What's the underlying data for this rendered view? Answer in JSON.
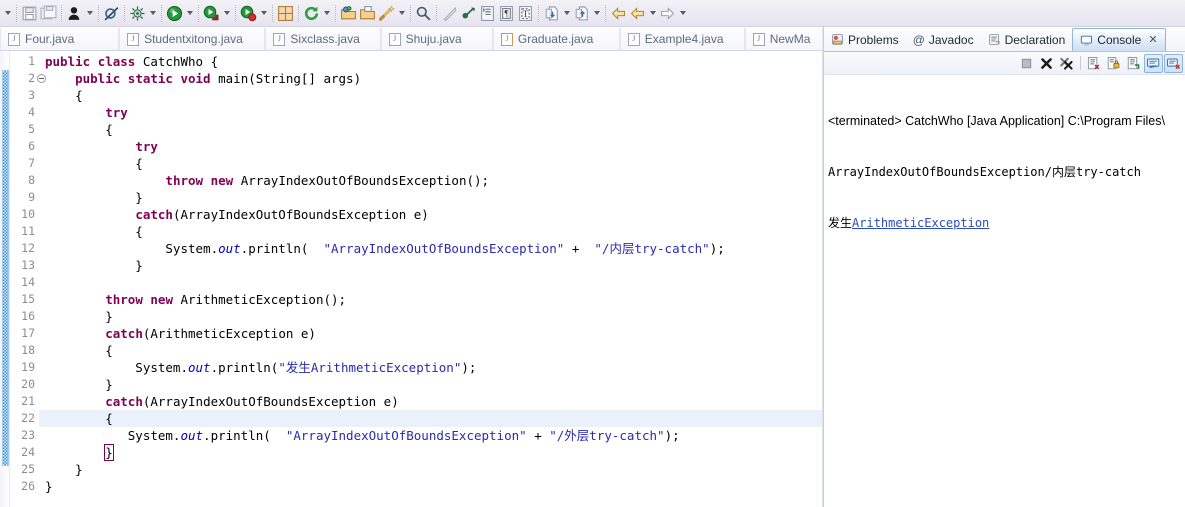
{
  "toolbar": {
    "items": [
      {
        "name": "toolbar-dropdown-arrow-0",
        "type": "arrow"
      },
      {
        "name": "separator-0",
        "type": "sep"
      },
      {
        "name": "save-icon",
        "type": "icon",
        "glyph": "save"
      },
      {
        "name": "save-all-icon",
        "type": "icon",
        "glyph": "save-all"
      },
      {
        "name": "separator-1",
        "type": "sep"
      },
      {
        "name": "run-person-icon",
        "type": "icon",
        "glyph": "person"
      },
      {
        "name": "run-person-dropdown-arrow",
        "type": "arrow"
      },
      {
        "name": "separator-2",
        "type": "sep"
      },
      {
        "name": "skip-breakpoints-icon",
        "type": "icon",
        "glyph": "skip-bp"
      },
      {
        "name": "separator-3",
        "type": "sep"
      },
      {
        "name": "debug-icon",
        "type": "icon",
        "glyph": "bug"
      },
      {
        "name": "debug-dropdown-arrow",
        "type": "arrow"
      },
      {
        "name": "separator-4",
        "type": "sep"
      },
      {
        "name": "run-icon",
        "type": "icon",
        "glyph": "run"
      },
      {
        "name": "run-dropdown-arrow",
        "type": "arrow"
      },
      {
        "name": "separator-5",
        "type": "sep"
      },
      {
        "name": "run-external-tools-icon",
        "type": "icon",
        "glyph": "ext-run"
      },
      {
        "name": "run-external-dropdown-arrow",
        "type": "arrow"
      },
      {
        "name": "separator-6",
        "type": "sep"
      },
      {
        "name": "run-coverage-icon",
        "type": "icon",
        "glyph": "cov-run"
      },
      {
        "name": "run-coverage-dropdown-arrow",
        "type": "arrow"
      },
      {
        "name": "separator-7",
        "type": "sep"
      },
      {
        "name": "new-package-icon",
        "type": "icon",
        "glyph": "package"
      },
      {
        "name": "separator-8",
        "type": "sep"
      },
      {
        "name": "refresh-icon",
        "type": "icon",
        "glyph": "refresh"
      },
      {
        "name": "refresh-dropdown-arrow",
        "type": "arrow"
      },
      {
        "name": "separator-9",
        "type": "sep"
      },
      {
        "name": "open-type-icon",
        "type": "icon",
        "glyph": "open-type"
      },
      {
        "name": "open-task-icon",
        "type": "icon",
        "glyph": "open-task"
      },
      {
        "name": "quick-fix-icon",
        "type": "icon",
        "glyph": "wand"
      },
      {
        "name": "quick-fix-dropdown-arrow",
        "type": "arrow"
      },
      {
        "name": "separator-10",
        "type": "sep"
      },
      {
        "name": "search-icon",
        "type": "icon",
        "glyph": "search"
      },
      {
        "name": "separator-11",
        "type": "sep"
      },
      {
        "name": "next-annotation-icon",
        "type": "icon",
        "glyph": "next-ann"
      },
      {
        "name": "link-icon",
        "type": "icon",
        "glyph": "link"
      },
      {
        "name": "toggle-mark-icon",
        "type": "icon",
        "glyph": "mark"
      },
      {
        "name": "show-whitespace-icon",
        "type": "icon",
        "glyph": "whitespace"
      },
      {
        "name": "block-selection-icon",
        "type": "icon",
        "glyph": "block-sel"
      },
      {
        "name": "separator-12",
        "type": "sep"
      },
      {
        "name": "next-edit-icon",
        "type": "icon",
        "glyph": "next-edit"
      },
      {
        "name": "next-edit-dropdown-arrow",
        "type": "arrow"
      },
      {
        "name": "prev-edit-icon",
        "type": "icon",
        "glyph": "prev-edit"
      },
      {
        "name": "prev-edit-dropdown-arrow",
        "type": "arrow"
      },
      {
        "name": "separator-13",
        "type": "sep"
      },
      {
        "name": "back-icon",
        "type": "icon",
        "glyph": "back"
      },
      {
        "name": "back-2-icon",
        "type": "icon",
        "glyph": "back"
      },
      {
        "name": "back-dropdown-arrow",
        "type": "arrow"
      },
      {
        "name": "forward-icon",
        "type": "icon",
        "glyph": "forward"
      },
      {
        "name": "forward-dropdown-arrow",
        "type": "arrow"
      }
    ]
  },
  "editor_tabs": [
    {
      "label": "Four.java",
      "modified": false
    },
    {
      "label": "Studentxitong.java",
      "modified": false
    },
    {
      "label": "Sixclass.java",
      "modified": false
    },
    {
      "label": "Shuju.java",
      "modified": false
    },
    {
      "label": "Graduate.java",
      "modified": true
    },
    {
      "label": "Example4.java",
      "modified": false
    },
    {
      "label": "NewMa",
      "modified": false
    }
  ],
  "console_panel": {
    "tabs": [
      {
        "label": "Problems",
        "icon": "problems-icon",
        "active": false
      },
      {
        "label": "Javadoc",
        "icon": "javadoc-icon",
        "active": false
      },
      {
        "label": "Declaration",
        "icon": "declaration-icon",
        "active": false
      },
      {
        "label": "Console",
        "icon": "console-icon",
        "active": true
      }
    ],
    "close_glyph": "✕",
    "toolbar_icons": [
      {
        "name": "terminate-icon",
        "glyph": "terminate",
        "selected": false
      },
      {
        "name": "remove-launch-icon",
        "glyph": "remove",
        "selected": false
      },
      {
        "name": "remove-all-terminated-icon",
        "glyph": "remove-all",
        "selected": false
      },
      {
        "name": "separator",
        "glyph": "sep",
        "selected": false
      },
      {
        "name": "clear-console-icon",
        "glyph": "clear",
        "selected": false
      },
      {
        "name": "scroll-lock-icon",
        "glyph": "lock",
        "selected": false
      },
      {
        "name": "pin-console-icon",
        "glyph": "pin",
        "selected": false
      },
      {
        "name": "display-selected-console-icon",
        "glyph": "display",
        "selected": true
      },
      {
        "name": "open-console-icon",
        "glyph": "open-console",
        "selected": true
      }
    ],
    "output": {
      "header": "<terminated> CatchWho [Java Application] C:\\Program Files\\",
      "line1": "ArrayIndexOutOfBoundsException/内层try-catch",
      "line2_prefix": "发生",
      "line2_link": "ArithmeticException"
    }
  },
  "code": {
    "total_lines": 26,
    "current_line": 22,
    "fold_marker_line": 2,
    "lines": [
      {
        "n": 1,
        "tokens": [
          {
            "t": "public",
            "c": "kw"
          },
          {
            "t": " ",
            "c": ""
          },
          {
            "t": "class",
            "c": "kw"
          },
          {
            "t": " CatchWho {",
            "c": ""
          }
        ]
      },
      {
        "n": 2,
        "tokens": [
          {
            "t": "    ",
            "c": ""
          },
          {
            "t": "public",
            "c": "kw"
          },
          {
            "t": " ",
            "c": ""
          },
          {
            "t": "static",
            "c": "kw"
          },
          {
            "t": " ",
            "c": ""
          },
          {
            "t": "void",
            "c": "kw"
          },
          {
            "t": " main(String[] args)",
            "c": ""
          }
        ]
      },
      {
        "n": 3,
        "tokens": [
          {
            "t": "    {",
            "c": ""
          }
        ]
      },
      {
        "n": 4,
        "tokens": [
          {
            "t": "        ",
            "c": ""
          },
          {
            "t": "try",
            "c": "kw"
          }
        ]
      },
      {
        "n": 5,
        "tokens": [
          {
            "t": "        {",
            "c": ""
          }
        ]
      },
      {
        "n": 6,
        "tokens": [
          {
            "t": "            ",
            "c": ""
          },
          {
            "t": "try",
            "c": "kw"
          }
        ]
      },
      {
        "n": 7,
        "tokens": [
          {
            "t": "            {",
            "c": ""
          }
        ]
      },
      {
        "n": 8,
        "tokens": [
          {
            "t": "                ",
            "c": ""
          },
          {
            "t": "throw",
            "c": "kw"
          },
          {
            "t": " ",
            "c": ""
          },
          {
            "t": "new",
            "c": "kw"
          },
          {
            "t": " ArrayIndexOutOfBoundsException();",
            "c": ""
          }
        ]
      },
      {
        "n": 9,
        "tokens": [
          {
            "t": "            }",
            "c": ""
          }
        ]
      },
      {
        "n": 10,
        "tokens": [
          {
            "t": "            ",
            "c": ""
          },
          {
            "t": "catch",
            "c": "kw"
          },
          {
            "t": "(ArrayIndexOutOfBoundsException e)",
            "c": ""
          }
        ]
      },
      {
        "n": 11,
        "tokens": [
          {
            "t": "            {",
            "c": ""
          }
        ]
      },
      {
        "n": 12,
        "tokens": [
          {
            "t": "                System.",
            "c": ""
          },
          {
            "t": "out",
            "c": "fld"
          },
          {
            "t": ".println(  ",
            "c": ""
          },
          {
            "t": "\"ArrayIndexOutOfBoundsException\"",
            "c": "str"
          },
          {
            "t": " + ",
            "c": ""
          },
          {
            "t": " \"/内层try-catch\"",
            "c": "str"
          },
          {
            "t": ");",
            "c": ""
          }
        ]
      },
      {
        "n": 13,
        "tokens": [
          {
            "t": "            }",
            "c": ""
          }
        ]
      },
      {
        "n": 14,
        "tokens": [
          {
            "t": "",
            "c": ""
          }
        ]
      },
      {
        "n": 15,
        "tokens": [
          {
            "t": "        ",
            "c": ""
          },
          {
            "t": "throw",
            "c": "kw"
          },
          {
            "t": " ",
            "c": ""
          },
          {
            "t": "new",
            "c": "kw"
          },
          {
            "t": " ArithmeticException();",
            "c": ""
          }
        ]
      },
      {
        "n": 16,
        "tokens": [
          {
            "t": "        }",
            "c": ""
          }
        ]
      },
      {
        "n": 17,
        "tokens": [
          {
            "t": "        ",
            "c": ""
          },
          {
            "t": "catch",
            "c": "kw"
          },
          {
            "t": "(ArithmeticException e)",
            "c": ""
          }
        ]
      },
      {
        "n": 18,
        "tokens": [
          {
            "t": "        {",
            "c": ""
          }
        ]
      },
      {
        "n": 19,
        "tokens": [
          {
            "t": "            System.",
            "c": ""
          },
          {
            "t": "out",
            "c": "fld"
          },
          {
            "t": ".println(",
            "c": ""
          },
          {
            "t": "\"发生ArithmeticException\"",
            "c": "str"
          },
          {
            "t": ");",
            "c": ""
          }
        ]
      },
      {
        "n": 20,
        "tokens": [
          {
            "t": "        }",
            "c": ""
          }
        ]
      },
      {
        "n": 21,
        "tokens": [
          {
            "t": "        ",
            "c": ""
          },
          {
            "t": "catch",
            "c": "kw"
          },
          {
            "t": "(ArrayIndexOutOfBoundsException e)",
            "c": ""
          }
        ]
      },
      {
        "n": 22,
        "tokens": [
          {
            "t": "        {",
            "c": ""
          }
        ]
      },
      {
        "n": 23,
        "tokens": [
          {
            "t": "           System.",
            "c": ""
          },
          {
            "t": "out",
            "c": "fld"
          },
          {
            "t": ".println(  ",
            "c": ""
          },
          {
            "t": "\"ArrayIndexOutOfBoundsException\"",
            "c": "str"
          },
          {
            "t": " + ",
            "c": ""
          },
          {
            "t": "\"/外层try-catch\"",
            "c": "str"
          },
          {
            "t": ");",
            "c": ""
          }
        ]
      },
      {
        "n": 24,
        "tokens": [
          {
            "t": "        ",
            "c": ""
          },
          {
            "t": "}",
            "c": "brk"
          }
        ]
      },
      {
        "n": 25,
        "tokens": [
          {
            "t": "    }",
            "c": ""
          }
        ]
      },
      {
        "n": 26,
        "tokens": [
          {
            "t": "}",
            "c": ""
          }
        ]
      }
    ]
  },
  "colors": {
    "keyword": "#7f0055",
    "string": "#2a2ab0",
    "field": "#0000c0",
    "link": "#2b4eb8",
    "current_line_bg": "#eaf1fb",
    "change_bar": "#3b8fd6",
    "toolbar_bg": "#eceaf3"
  }
}
